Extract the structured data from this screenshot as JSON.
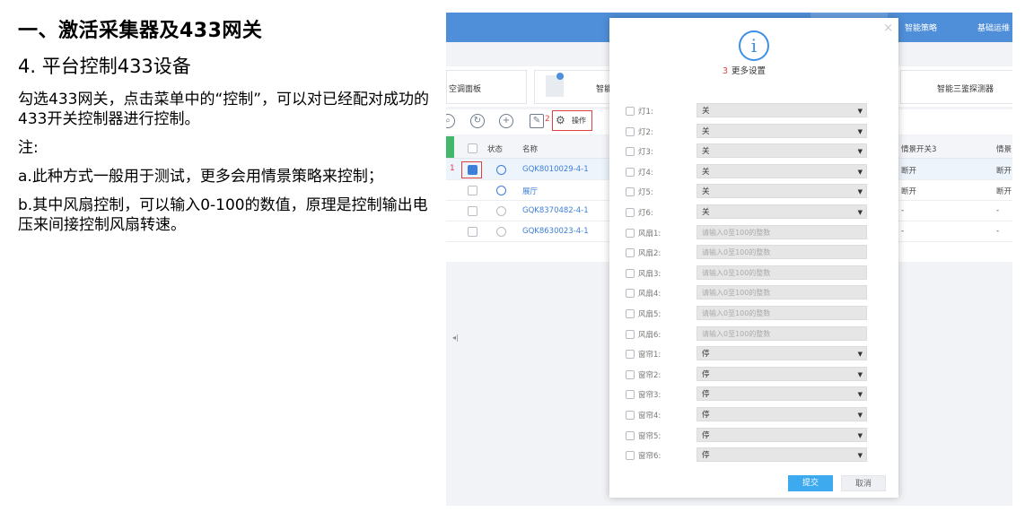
{
  "doc": {
    "heading": "一、激活采集器及433网关",
    "subheading": "4.  平台控制433设备",
    "para1": "勾选433网关，点击菜单中的“控制”，可以对已经配对成功的433开关控制器进行控制。",
    "note": "注:",
    "para2": "a.此种方式一般用于测试，更多会用情景策略来控制；",
    "para3": "b.其中风扇控制，可以输入0-100的数值，原理是控制输出电压来间接控制风扇转速。"
  },
  "app": {
    "nav": [
      "智能策略",
      "基础运维"
    ],
    "tiles": [
      "空调面板",
      "智能",
      "智能三鉴探测器"
    ],
    "toolbar": {
      "op_label": "操作",
      "step2": "2"
    },
    "table": {
      "headers": [
        "状态",
        "名称",
        "情景开关3",
        "情景"
      ],
      "rows": [
        {
          "name": "GQK8010029-4-1",
          "sw3": "断开",
          "sw4": "断开",
          "checked": true
        },
        {
          "name": "展厅",
          "sw3": "断开",
          "sw4": "断开",
          "checked": false
        },
        {
          "name": "GQK8370482-4-1",
          "sw3": "-",
          "sw4": "-",
          "checked": false
        },
        {
          "name": "GQK8630023-4-1",
          "sw3": "-",
          "sw4": "-",
          "checked": false
        }
      ],
      "step1": "1"
    },
    "collapse_arrow": "◂|"
  },
  "modal": {
    "close": "×",
    "info_glyph": "i",
    "step3": "3",
    "title": "更多设置",
    "fields": [
      {
        "label": "灯1:",
        "kind": "select",
        "value": "关"
      },
      {
        "label": "灯2:",
        "kind": "select",
        "value": "关"
      },
      {
        "label": "灯3:",
        "kind": "select",
        "value": "关"
      },
      {
        "label": "灯4:",
        "kind": "select",
        "value": "关"
      },
      {
        "label": "灯5:",
        "kind": "select",
        "value": "关"
      },
      {
        "label": "灯6:",
        "kind": "select",
        "value": "关"
      },
      {
        "label": "风扇1:",
        "kind": "input",
        "value": "请输入0至100的整数"
      },
      {
        "label": "风扇2:",
        "kind": "input",
        "value": "请输入0至100的整数"
      },
      {
        "label": "风扇3:",
        "kind": "input",
        "value": "请输入0至100的整数"
      },
      {
        "label": "风扇4:",
        "kind": "input",
        "value": "请输入0至100的整数"
      },
      {
        "label": "风扇5:",
        "kind": "input",
        "value": "请输入0至100的整数"
      },
      {
        "label": "风扇6:",
        "kind": "input",
        "value": "请输入0至100的整数"
      },
      {
        "label": "窗帘1:",
        "kind": "select",
        "value": "停"
      },
      {
        "label": "窗帘2:",
        "kind": "select",
        "value": "停"
      },
      {
        "label": "窗帘3:",
        "kind": "select",
        "value": "停"
      },
      {
        "label": "窗帘4:",
        "kind": "select",
        "value": "停"
      },
      {
        "label": "窗帘5:",
        "kind": "select",
        "value": "停"
      },
      {
        "label": "窗帘6:",
        "kind": "select",
        "value": "停"
      }
    ],
    "submit": "提交",
    "cancel": "取消",
    "select_arrow": "▼"
  },
  "colors": {
    "accent": "#3d8fe8",
    "topbar": "#4f8fd9",
    "highlight": "#e04040",
    "submit": "#3da9ee"
  }
}
